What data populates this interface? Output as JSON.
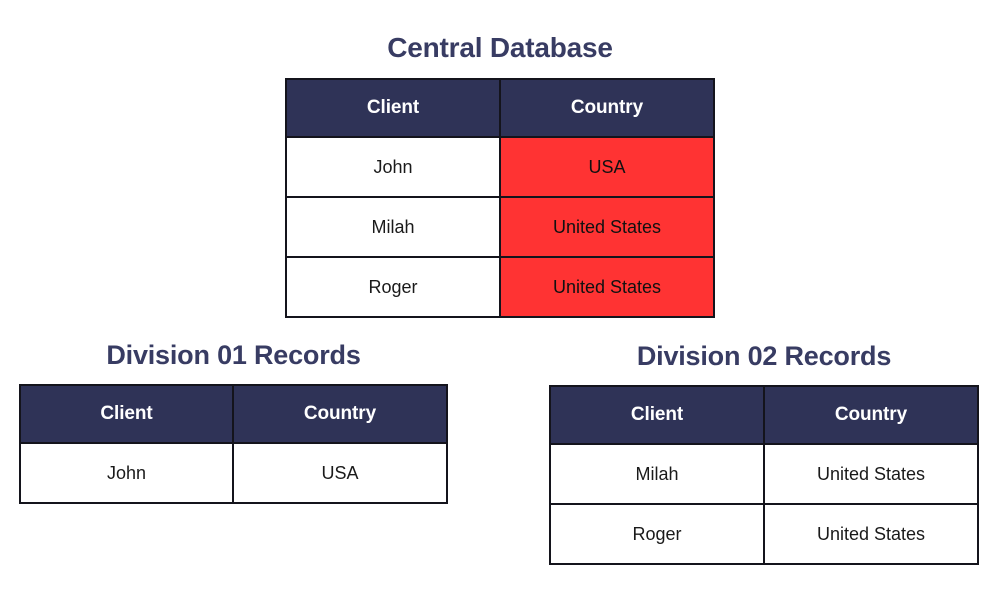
{
  "colors": {
    "header_navy": "#2f3357",
    "title_navy": "#383c63",
    "highlight_red": "#ff3333",
    "border": "#14141c",
    "page_background": "#ffffff",
    "header_text": "#ffffff",
    "cell_text": "#1a1a1a"
  },
  "central": {
    "title": "Central Database",
    "columns": [
      "Client",
      "Country"
    ],
    "rows": [
      {
        "client": "John",
        "country": "USA",
        "country_highlighted": true
      },
      {
        "client": "Milah",
        "country": "United States",
        "country_highlighted": true
      },
      {
        "client": "Roger",
        "country": "United States",
        "country_highlighted": true
      }
    ]
  },
  "division01": {
    "title": "Division 01 Records",
    "columns": [
      "Client",
      "Country"
    ],
    "rows": [
      {
        "client": "John",
        "country": "USA",
        "country_highlighted": false
      }
    ]
  },
  "division02": {
    "title": "Division 02 Records",
    "columns": [
      "Client",
      "Country"
    ],
    "rows": [
      {
        "client": "Milah",
        "country": "United States",
        "country_highlighted": false
      },
      {
        "client": "Roger",
        "country": "United States",
        "country_highlighted": false
      }
    ]
  }
}
